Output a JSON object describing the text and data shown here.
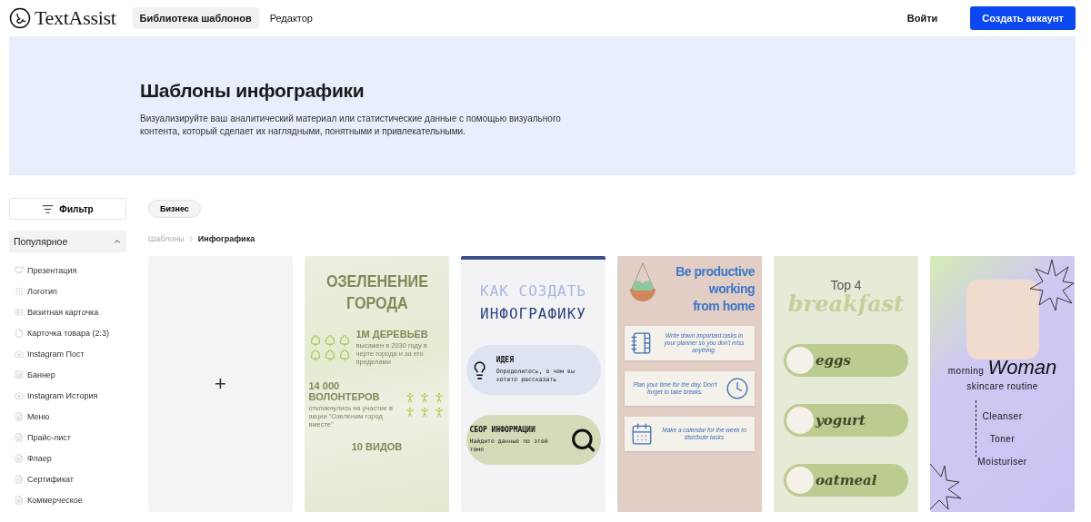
{
  "header": {
    "logo": "TextAssist",
    "nav": [
      {
        "label": "Библиотека шаблонов",
        "selected": true
      },
      {
        "label": "Редактор",
        "selected": false
      }
    ],
    "login": "Войти",
    "signup": "Создать аккаунт"
  },
  "hero": {
    "title": "Шаблоны инфографики",
    "description": "Визуализируйте ваш аналитический материал или статистические данные с помощью визуального контента, который сделает их наглядными, понятными и привлекательными."
  },
  "sidebar": {
    "filter": "Фильтр",
    "section": {
      "title": "Популярное",
      "expanded": true,
      "items": [
        "Презентация",
        "Логотип",
        "Визитная карточка",
        "Карточка товара (2:3)",
        "Instagram Пост",
        "Баннер",
        "Instagram История",
        "Меню",
        "Прайс-лист",
        "Флаер",
        "Сертификат",
        "Коммерческое"
      ]
    }
  },
  "chips": [
    {
      "label": "Бизнес"
    }
  ],
  "breadcrumb": [
    "Шаблоны",
    "Инфографика"
  ],
  "cards": [
    {
      "kind": "blank",
      "symbol": "+"
    },
    {
      "kind": "green",
      "title": [
        "ОЗЕЛЕНЕНИЕ",
        "ГОРОДА"
      ],
      "stats": [
        {
          "value": "1М ДЕРЕВЬЕВ",
          "note": "высажен в 2030 году в черте города и за его пределами"
        },
        {
          "value": "14 000 ВОЛОНТЕРОВ",
          "note": "откликнулись на участие в акции \"Озеленим город вместе\""
        },
        {
          "value": "10 ВИДОВ"
        }
      ]
    },
    {
      "kind": "howto",
      "title": [
        "КАК СОЗДАТЬ",
        "ИНФОГРАФИКУ"
      ],
      "steps": [
        {
          "heading": "ИДЕЯ",
          "text": "Определитесь, о чем вы хотите рассказать"
        },
        {
          "heading": "СБОР ИНФОРМАЦИИ",
          "text": "Найдите данные по этой теме"
        }
      ]
    },
    {
      "kind": "productive",
      "title": [
        "Be productive",
        "working",
        "from home"
      ],
      "notes": [
        "Write down important tasks in your planner so you don't miss anything.",
        "Plan your time for the day. Don't forget to take breaks.",
        "Make a calendar for the week to distribute tasks"
      ]
    },
    {
      "kind": "breakfast",
      "heading": "Top 4",
      "script": "breakfast",
      "items": [
        "eggs",
        "yogurt",
        "oatmeal"
      ]
    },
    {
      "kind": "skincare",
      "lead": "morning",
      "script": "Woman",
      "subtitle": "skincare routine",
      "steps": [
        "Cleanser",
        "Toner",
        "Moisturiser"
      ]
    }
  ]
}
